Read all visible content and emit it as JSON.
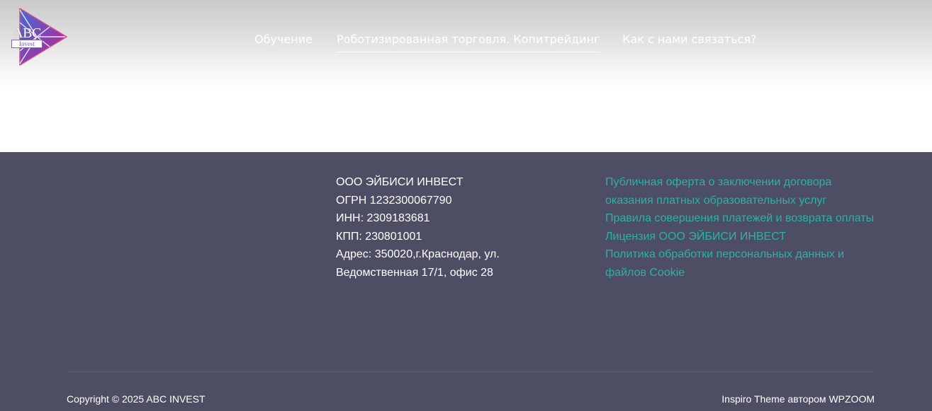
{
  "logo": {
    "text": "ABC",
    "sub": "Invest",
    "icon": "play-triangle-logo"
  },
  "nav": {
    "items": [
      {
        "label": "Обучение"
      },
      {
        "label": "Роботизированная торговля. Копитрейдинг",
        "active": true
      },
      {
        "label": "Как с нами связаться?"
      }
    ]
  },
  "footer": {
    "company": {
      "lines": [
        "ООО  ЭЙБИСИ ИНВЕСТ",
        "ОГРН 1232300067790",
        "ИНН: 2309183681",
        "КПП: 230801001",
        "Адрес: 350020,г.Краснодар, ул.",
        "Ведомственная 17/1, офис 28"
      ]
    },
    "links": [
      {
        "label": "Публичная оферта о заключении договора оказания платных образовательных услуг"
      },
      {
        "label": "Правила совершения платежей и возврата оплаты"
      },
      {
        "label": "Лицензия ООО ЭЙБИСИ ИНВЕСТ"
      },
      {
        "label": "Политика обработки персональных данных и файлов Cookie"
      }
    ],
    "copyright": "Copyright © 2025 ABC INVEST",
    "credit": "Inspiro Theme автором WPZOOM"
  },
  "colors": {
    "footer_bg": "#4d4d64",
    "link": "#2ab2a6",
    "logo_gradient_start": "#3f6ed6",
    "logo_gradient_end": "#c2287a"
  }
}
